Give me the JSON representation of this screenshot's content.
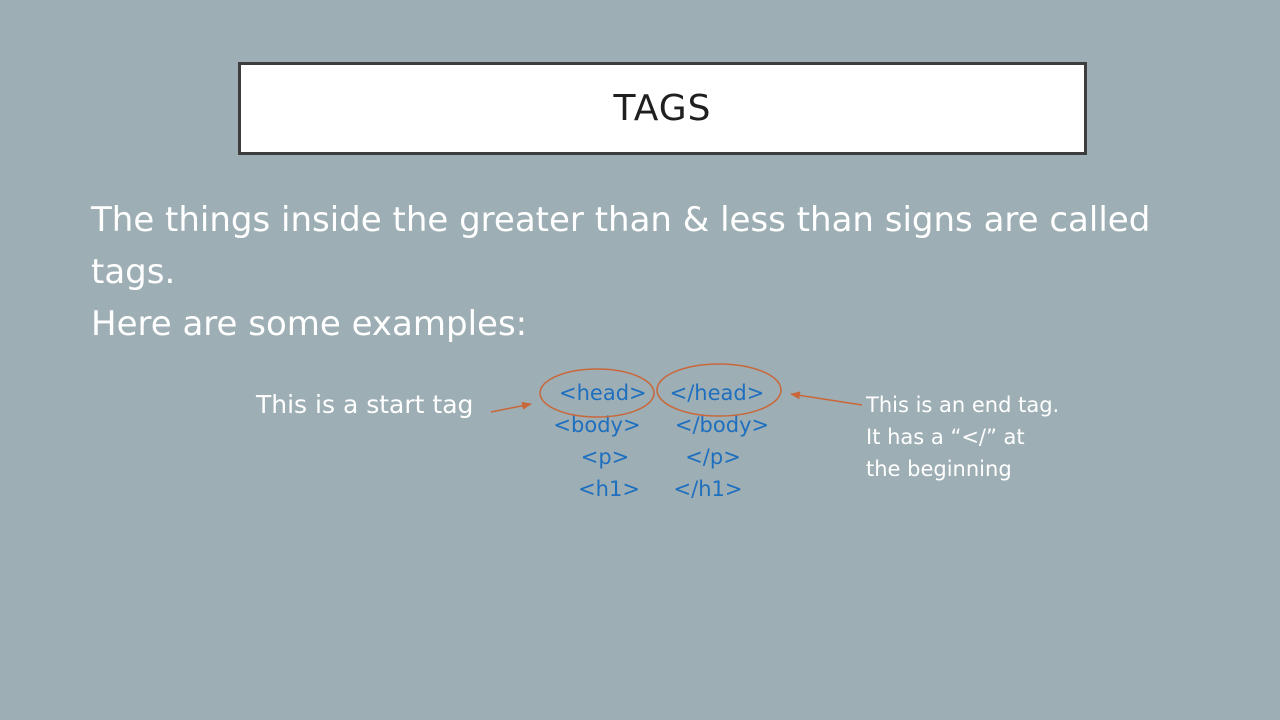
{
  "slide": {
    "title": "TAGS",
    "body_lines": [
      "The things inside the greater than & less than signs are called",
      "tags.",
      "Here are some examples:"
    ],
    "start_tag_note": "This is a start tag",
    "end_tag_note_lines": [
      "This is an end tag.",
      "It has a “</” at",
      "the beginning"
    ],
    "start_tags": [
      "<head>",
      "<body>",
      "<p>",
      "<h1>"
    ],
    "end_tags": [
      "</head>",
      "</body>",
      "</p>",
      "</h1>"
    ]
  },
  "colors": {
    "background": "#9daeb4",
    "tag_text": "#1f6fbf",
    "annotation": "#c9673a",
    "title_border": "#3d3d3d"
  }
}
